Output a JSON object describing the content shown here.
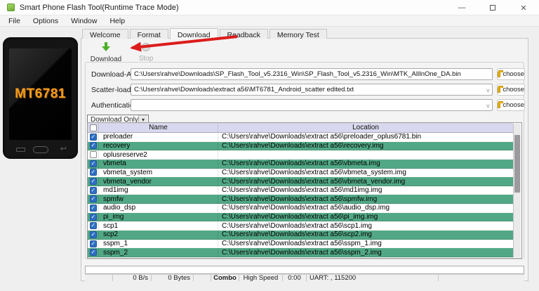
{
  "window": {
    "title": "Smart Phone Flash Tool(Runtime Trace Mode)",
    "controls": {
      "minimize": "—",
      "close": "✕"
    }
  },
  "menu": {
    "items": [
      {
        "label": "File"
      },
      {
        "label": "Options"
      },
      {
        "label": "Window"
      },
      {
        "label": "Help"
      }
    ]
  },
  "phone": {
    "label": "MT6781",
    "back_icon": "↩"
  },
  "tabs": [
    {
      "label": "Welcome"
    },
    {
      "label": "Format"
    },
    {
      "label": "Download"
    },
    {
      "label": "Readback"
    },
    {
      "label": "Memory Test"
    }
  ],
  "active_tab": "Download",
  "toolbar": {
    "download_label": "Download",
    "stop_label": "Stop"
  },
  "form": {
    "download_agent": {
      "label": "Download-Agent",
      "value": "C:\\Users\\rahve\\Downloads\\SP_Flash_Tool_v5.2316_Win\\SP_Flash_Tool_v5.2316_Win\\MTK_AllInOne_DA.bin"
    },
    "scatter_file": {
      "label": "Scatter-loading File",
      "value": "C:\\Users\\rahve\\Downloads\\extract a56\\MT6781_Android_scatter edited.txt",
      "caret": "˅"
    },
    "auth_file": {
      "label": "Authentication File",
      "value": "",
      "caret": "˅"
    },
    "choose_label": "choose",
    "mode_select": {
      "value": "Download Only",
      "caret": "▾"
    }
  },
  "table": {
    "headers": {
      "name": "Name",
      "location": "Location"
    },
    "rows": [
      {
        "checked": true,
        "green": false,
        "name": "preloader",
        "location": "C:\\Users\\rahve\\Downloads\\extract a56\\preloader_oplus6781.bin"
      },
      {
        "checked": true,
        "green": true,
        "name": "recovery",
        "location": "C:\\Users\\rahve\\Downloads\\extract a56\\recovery.img"
      },
      {
        "checked": false,
        "green": false,
        "name": "oplusreserve2",
        "location": ""
      },
      {
        "checked": true,
        "green": true,
        "name": "vbmeta",
        "location": "C:\\Users\\rahve\\Downloads\\extract a56\\vbmeta.img"
      },
      {
        "checked": true,
        "green": false,
        "name": "vbmeta_system",
        "location": "C:\\Users\\rahve\\Downloads\\extract a56\\vbmeta_system.img"
      },
      {
        "checked": true,
        "green": true,
        "name": "vbmeta_vendor",
        "location": "C:\\Users\\rahve\\Downloads\\extract a56\\vbmeta_vendor.img"
      },
      {
        "checked": true,
        "green": false,
        "name": "md1img",
        "location": "C:\\Users\\rahve\\Downloads\\extract a56\\md1img.img"
      },
      {
        "checked": true,
        "green": true,
        "name": "spmfw",
        "location": "C:\\Users\\rahve\\Downloads\\extract a56\\spmfw.img"
      },
      {
        "checked": true,
        "green": false,
        "name": "audio_dsp",
        "location": "C:\\Users\\rahve\\Downloads\\extract a56\\audio_dsp.img"
      },
      {
        "checked": true,
        "green": true,
        "name": "pi_img",
        "location": "C:\\Users\\rahve\\Downloads\\extract a56\\pi_img.img"
      },
      {
        "checked": true,
        "green": false,
        "name": "scp1",
        "location": "C:\\Users\\rahve\\Downloads\\extract a56\\scp1.img"
      },
      {
        "checked": true,
        "green": true,
        "name": "scp2",
        "location": "C:\\Users\\rahve\\Downloads\\extract a56\\scp2.img"
      },
      {
        "checked": true,
        "green": false,
        "name": "sspm_1",
        "location": "C:\\Users\\rahve\\Downloads\\extract a56\\sspm_1.img"
      },
      {
        "checked": true,
        "green": true,
        "name": "sspm_2",
        "location": "C:\\Users\\rahve\\Downloads\\extract a56\\sspm_2.img"
      }
    ]
  },
  "statusbar": {
    "speed": "0 B/s",
    "bytes": "0 Bytes",
    "mode": "Combo",
    "speed_mode": "High Speed",
    "time": "0:00",
    "uart": "UART: , 115200"
  },
  "colors": {
    "green": "#52A886",
    "blue": "#2D6FC2",
    "red": "#DC1C1C",
    "lavender": "#D8D8EE",
    "orange": "#F49B20",
    "dlgreen": "#4CAF28",
    "folder": "#EDB40E"
  }
}
